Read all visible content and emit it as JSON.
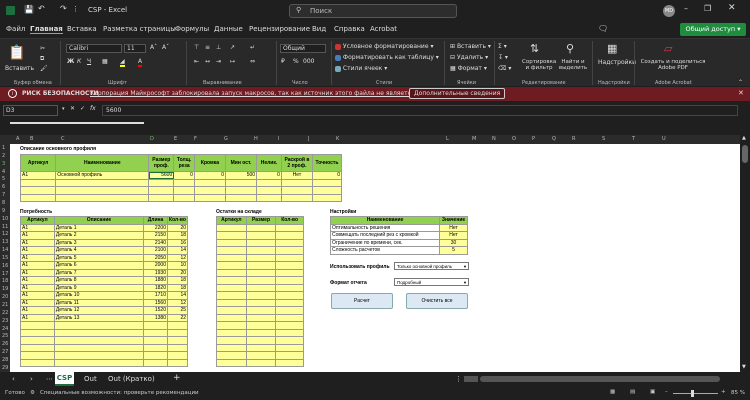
{
  "titlebar": {
    "app_title": "CSP - Excel",
    "search_placeholder": "Поиск",
    "user_initials": "MD"
  },
  "menu": {
    "tabs": [
      "Файл",
      "Главная",
      "Вставка",
      "Разметка страницы",
      "Формулы",
      "Данные",
      "Рецензирование",
      "Вид",
      "Справка",
      "Acrobat"
    ],
    "share_label": "Общий доступ"
  },
  "ribbon": {
    "clipboard_group": "Буфер обмена",
    "font_group": "Шрифт",
    "align_group": "Выравнивание",
    "number_group": "Число",
    "styles_group": "Стили",
    "cells_group": "Ячейки",
    "edit_group": "Редактирование",
    "addins_group": "Надстройки",
    "acrobat_group": "Adobe Acrobat",
    "paste_label": "Вставить",
    "font_name": "Calibri",
    "font_size": "11",
    "number_format": "Общий",
    "cond_format": "Условное форматирование",
    "format_table": "Форматировать как таблицу",
    "cell_styles": "Стили ячеек",
    "insert": "Вставить",
    "delete": "Удалить",
    "format": "Формат",
    "sort_filter": "Сортировка и фильтр",
    "find_select": "Найти и выделить",
    "addins": "Надстройки",
    "create_pdf": "Создать и поделиться Adobe PDF"
  },
  "security": {
    "title": "РИСК БЕЗОПАСНОСТИ",
    "message": "Корпорация Майкрософт заблокировала запуск макросов, так как источник этого файла не является доверенным.",
    "button": "Дополнительные сведения"
  },
  "formula": {
    "cell_ref": "D3",
    "fx": "fx",
    "value": "5600"
  },
  "columns": [
    "A",
    "B",
    "C",
    "D",
    "E",
    "F",
    "G",
    "H",
    "I",
    "J",
    "K",
    "L",
    "M",
    "N",
    "O",
    "P",
    "Q",
    "R",
    "S",
    "T",
    "U"
  ],
  "rows": [
    "1",
    "2",
    "3",
    "4",
    "5",
    "6",
    "7",
    "8",
    "9",
    "10",
    "11",
    "12",
    "13",
    "14",
    "15",
    "16",
    "17",
    "18",
    "19",
    "20",
    "21",
    "22",
    "23",
    "24",
    "25",
    "26",
    "27",
    "28",
    "29"
  ],
  "profile": {
    "title": "Описание основного профиля",
    "headers": [
      "Артикул",
      "Наименование",
      "Размер проф.",
      "Толщ. реза",
      "Кромка",
      "Мин ост.",
      "Нелик.",
      "Раскрой в 2 проф.",
      "Точность"
    ],
    "row": [
      "A1",
      "Основной профиль",
      "5600",
      "0",
      "0",
      "500",
      "0",
      "Нет",
      "0"
    ]
  },
  "need": {
    "title": "Потребность",
    "headers": [
      "Артикул",
      "Описание",
      "Длина",
      "Кол-во"
    ],
    "rows": [
      [
        "A1",
        "Деталь 1",
        "2200",
        "20"
      ],
      [
        "A1",
        "Деталь 2",
        "2150",
        "18"
      ],
      [
        "A1",
        "Деталь 3",
        "2140",
        "16"
      ],
      [
        "A1",
        "Деталь 4",
        "2100",
        "14"
      ],
      [
        "A1",
        "Деталь 5",
        "2050",
        "12"
      ],
      [
        "A1",
        "Деталь 6",
        "2000",
        "10"
      ],
      [
        "A1",
        "Деталь 7",
        "1930",
        "20"
      ],
      [
        "A1",
        "Деталь 8",
        "1880",
        "18"
      ],
      [
        "A1",
        "Деталь 9",
        "1820",
        "18"
      ],
      [
        "A1",
        "Деталь 10",
        "1710",
        "14"
      ],
      [
        "A1",
        "Деталь 11",
        "1560",
        "12"
      ],
      [
        "A1",
        "Деталь 12",
        "1520",
        "25"
      ],
      [
        "A1",
        "Деталь 13",
        "1380",
        "22"
      ]
    ]
  },
  "stock": {
    "title": "Остатки на складе",
    "headers": [
      "Артикул",
      "Размер",
      "Кол-во"
    ]
  },
  "settings": {
    "title": "Настройки",
    "headers": [
      "Наименование",
      "Значение"
    ],
    "rows": [
      [
        "Оптимальность решения",
        "Нет"
      ],
      [
        "Совмещать последний рез с кромкой",
        "Нет"
      ],
      [
        "Ограничение по времени, сек.",
        "30"
      ],
      [
        "Сложность расчетов",
        "5"
      ]
    ],
    "use_profile_label": "Использовать профиль",
    "use_profile_value": "Только основной профиль",
    "report_label": "Формат отчета",
    "report_value": "Подробный",
    "calc_button": "Расчет",
    "clear_button": "Очистить все"
  },
  "sheets": {
    "tabs": [
      "CSP",
      "Out",
      "Out (Кратко)"
    ],
    "active": "CSP"
  },
  "status": {
    "ready": "Готово",
    "accessibility": "Специальные возможности: проверьте рекомендации",
    "zoom": "85 %"
  }
}
